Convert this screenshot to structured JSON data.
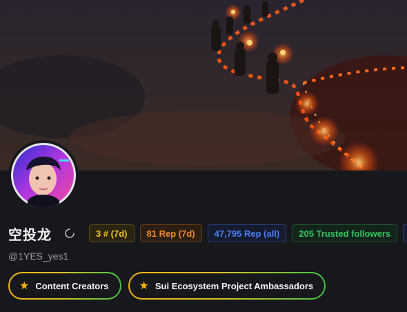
{
  "profile": {
    "display_name": "空投龙",
    "handle": "@1YES_yes1",
    "avatar_icon": "avatar-portrait-icon",
    "banner_icon": "torch-walkers-banner-image"
  },
  "stats": {
    "rank": "3 # (7d)",
    "rep_7d": "81 Rep (7d)",
    "rep_all": "47,795 Rep (all)",
    "trusted_followers": "205 Trusted followers"
  },
  "badges": [
    {
      "icon": "star-icon",
      "label": "Content Creators"
    },
    {
      "icon": "star-icon",
      "label": "Sui Ecosystem Project Ambassadors"
    }
  ],
  "colors": {
    "background": "#17181c",
    "rank": "#f0c22c",
    "rep_7d": "#f08a2c",
    "rep_all": "#4b7ff0",
    "followers": "#34c260",
    "star": "#f5b60f"
  }
}
